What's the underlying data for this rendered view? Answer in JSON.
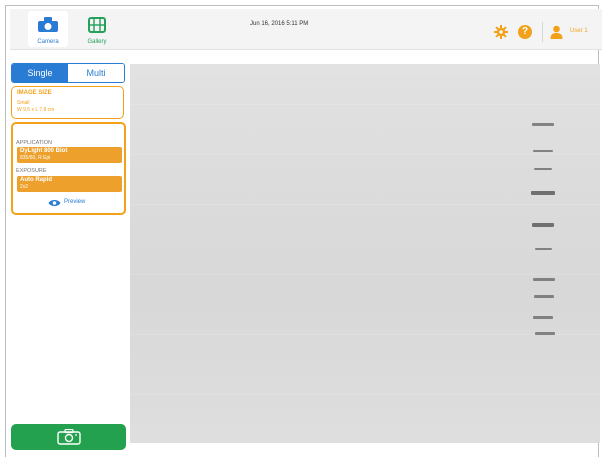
{
  "topbar": {
    "camera_label": "Camera",
    "gallery_label": "Gallery",
    "datetime": "Jun 16, 2016  5:11 PM",
    "help_label": "?",
    "user_label": "User 1"
  },
  "mode": {
    "single": "Single",
    "multi": "Multi",
    "selected": "Single"
  },
  "image_size": {
    "heading": "IMAGE SIZE",
    "size": "Small",
    "dimensions": "W 9.5 x L 7.8 cm"
  },
  "application": {
    "label": "APPLICATION",
    "value_line1": "DyLight 800 Blot",
    "value_line2": "835/60, R Epi"
  },
  "exposure": {
    "label": "EXPOSURE",
    "value_line1": "Auto Rapid",
    "value_line2": "2x2"
  },
  "preview_label": "Preview",
  "colors": {
    "accent_blue": "#2a7bd4",
    "accent_orange": "#f2a21a",
    "capture_green": "#24a14f"
  }
}
